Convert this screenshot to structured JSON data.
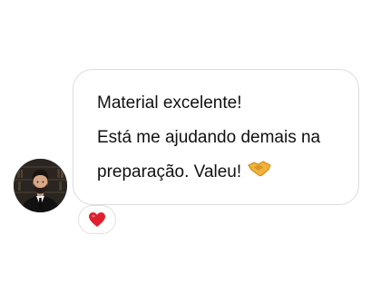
{
  "message": {
    "lines": [
      "Material excelente!",
      "Está me ajudando demais na",
      "preparação. Valeu!"
    ],
    "trailing_icon": "handshake-icon"
  },
  "avatar": {
    "icon": "profile-photo"
  },
  "reaction": {
    "icon": "red-heart-icon",
    "color": "#e0202e"
  },
  "colors": {
    "bubble_border": "#dcdcdc",
    "text": "#111111",
    "heart": "#e0202e",
    "handshake": "#f2b13a"
  }
}
